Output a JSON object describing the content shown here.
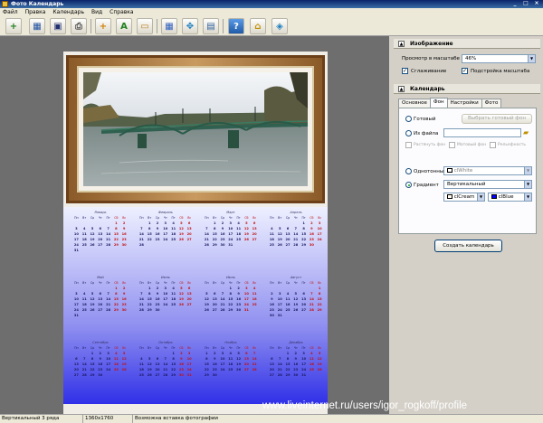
{
  "window": {
    "title": "Фото Календарь",
    "controls": [
      "_",
      "□",
      "×"
    ]
  },
  "menu": [
    "Файл",
    "Правка",
    "Календарь",
    "Вид",
    "Справка"
  ],
  "toolbar": {
    "buttons": [
      {
        "name": "open-folder-icon",
        "glyph": "+"
      },
      {
        "name": "calendar-icon",
        "glyph": "▦"
      },
      {
        "name": "save-icon",
        "glyph": "▣"
      },
      {
        "name": "print-icon",
        "glyph": "⎙"
      },
      {
        "name": "add-photo-icon",
        "glyph": "+"
      },
      {
        "name": "text-icon",
        "glyph": "A"
      },
      {
        "name": "image-icon",
        "glyph": "▭"
      },
      {
        "name": "grid-icon",
        "glyph": "▦"
      },
      {
        "name": "move-icon",
        "glyph": "✥"
      },
      {
        "name": "page-setup-icon",
        "glyph": "▤"
      },
      {
        "name": "help-icon",
        "glyph": "?"
      },
      {
        "name": "bag-icon",
        "glyph": "⌂"
      },
      {
        "name": "box-icon",
        "glyph": "◈"
      }
    ]
  },
  "calendar": {
    "weekdays": [
      "Пн",
      "Вт",
      "Ср",
      "Чт",
      "Пт",
      "Сб",
      "Вс"
    ],
    "months": [
      {
        "name": "Январь",
        "rows": [
          [
            "",
            "",
            "",
            "",
            "",
            "1",
            "2"
          ],
          [
            "3",
            "4",
            "5",
            "6",
            "7",
            "8",
            "9"
          ],
          [
            "10",
            "11",
            "12",
            "13",
            "14",
            "15",
            "16"
          ],
          [
            "17",
            "18",
            "19",
            "20",
            "21",
            "22",
            "23"
          ],
          [
            "24",
            "25",
            "26",
            "27",
            "28",
            "29",
            "30"
          ],
          [
            "31",
            "",
            "",
            "",
            "",
            "",
            ""
          ]
        ]
      },
      {
        "name": "Февраль",
        "rows": [
          [
            "",
            "1",
            "2",
            "3",
            "4",
            "5",
            "6"
          ],
          [
            "7",
            "8",
            "9",
            "10",
            "11",
            "12",
            "13"
          ],
          [
            "14",
            "15",
            "16",
            "17",
            "18",
            "19",
            "20"
          ],
          [
            "21",
            "22",
            "23",
            "24",
            "25",
            "26",
            "27"
          ],
          [
            "28",
            "",
            "",
            "",
            "",
            "",
            ""
          ]
        ]
      },
      {
        "name": "Март",
        "rows": [
          [
            "",
            "1",
            "2",
            "3",
            "4",
            "5",
            "6"
          ],
          [
            "7",
            "8",
            "9",
            "10",
            "11",
            "12",
            "13"
          ],
          [
            "14",
            "15",
            "16",
            "17",
            "18",
            "19",
            "20"
          ],
          [
            "21",
            "22",
            "23",
            "24",
            "25",
            "26",
            "27"
          ],
          [
            "28",
            "29",
            "30",
            "31",
            "",
            "",
            ""
          ]
        ]
      },
      {
        "name": "Апрель",
        "rows": [
          [
            "",
            "",
            "",
            "",
            "1",
            "2",
            "3"
          ],
          [
            "4",
            "5",
            "6",
            "7",
            "8",
            "9",
            "10"
          ],
          [
            "11",
            "12",
            "13",
            "14",
            "15",
            "16",
            "17"
          ],
          [
            "18",
            "19",
            "20",
            "21",
            "22",
            "23",
            "24"
          ],
          [
            "25",
            "26",
            "27",
            "28",
            "29",
            "30",
            ""
          ]
        ]
      },
      {
        "name": "Май",
        "rows": [
          [
            "",
            "",
            "",
            "",
            "",
            "1",
            "2"
          ],
          [
            "3",
            "4",
            "5",
            "6",
            "7",
            "8",
            "9"
          ],
          [
            "10",
            "11",
            "12",
            "13",
            "14",
            "15",
            "16"
          ],
          [
            "17",
            "18",
            "19",
            "20",
            "21",
            "22",
            "23"
          ],
          [
            "24",
            "25",
            "26",
            "27",
            "28",
            "29",
            "30"
          ],
          [
            "31",
            "",
            "",
            "",
            "",
            "",
            ""
          ]
        ]
      },
      {
        "name": "Июнь",
        "rows": [
          [
            "",
            "1",
            "2",
            "3",
            "4",
            "5",
            "6"
          ],
          [
            "7",
            "8",
            "9",
            "10",
            "11",
            "12",
            "13"
          ],
          [
            "14",
            "15",
            "16",
            "17",
            "18",
            "19",
            "20"
          ],
          [
            "21",
            "22",
            "23",
            "24",
            "25",
            "26",
            "27"
          ],
          [
            "28",
            "29",
            "30",
            "",
            "",
            "",
            ""
          ]
        ]
      },
      {
        "name": "Июль",
        "rows": [
          [
            "",
            "",
            "",
            "1",
            "2",
            "3",
            "4"
          ],
          [
            "5",
            "6",
            "7",
            "8",
            "9",
            "10",
            "11"
          ],
          [
            "12",
            "13",
            "14",
            "15",
            "16",
            "17",
            "18"
          ],
          [
            "19",
            "20",
            "21",
            "22",
            "23",
            "24",
            "25"
          ],
          [
            "26",
            "27",
            "28",
            "29",
            "30",
            "31",
            ""
          ]
        ]
      },
      {
        "name": "Август",
        "rows": [
          [
            "",
            "",
            "",
            "",
            "",
            "",
            "1"
          ],
          [
            "2",
            "3",
            "4",
            "5",
            "6",
            "7",
            "8"
          ],
          [
            "9",
            "10",
            "11",
            "12",
            "13",
            "14",
            "15"
          ],
          [
            "16",
            "17",
            "18",
            "19",
            "20",
            "21",
            "22"
          ],
          [
            "23",
            "24",
            "25",
            "26",
            "27",
            "28",
            "29"
          ],
          [
            "30",
            "31",
            "",
            "",
            "",
            "",
            ""
          ]
        ]
      },
      {
        "name": "Сентябрь",
        "rows": [
          [
            "",
            "",
            "1",
            "2",
            "3",
            "4",
            "5"
          ],
          [
            "6",
            "7",
            "8",
            "9",
            "10",
            "11",
            "12"
          ],
          [
            "13",
            "14",
            "15",
            "16",
            "17",
            "18",
            "19"
          ],
          [
            "20",
            "21",
            "22",
            "23",
            "24",
            "25",
            "26"
          ],
          [
            "27",
            "28",
            "29",
            "30",
            "",
            "",
            ""
          ]
        ]
      },
      {
        "name": "Октябрь",
        "rows": [
          [
            "",
            "",
            "",
            "",
            "1",
            "2",
            "3"
          ],
          [
            "4",
            "5",
            "6",
            "7",
            "8",
            "9",
            "10"
          ],
          [
            "11",
            "12",
            "13",
            "14",
            "15",
            "16",
            "17"
          ],
          [
            "18",
            "19",
            "20",
            "21",
            "22",
            "23",
            "24"
          ],
          [
            "25",
            "26",
            "27",
            "28",
            "29",
            "30",
            "31"
          ]
        ]
      },
      {
        "name": "Ноябрь",
        "rows": [
          [
            "1",
            "2",
            "3",
            "4",
            "5",
            "6",
            "7"
          ],
          [
            "8",
            "9",
            "10",
            "11",
            "12",
            "13",
            "14"
          ],
          [
            "15",
            "16",
            "17",
            "18",
            "19",
            "20",
            "21"
          ],
          [
            "22",
            "23",
            "24",
            "25",
            "26",
            "27",
            "28"
          ],
          [
            "29",
            "30",
            "",
            "",
            "",
            "",
            ""
          ]
        ]
      },
      {
        "name": "Декабрь",
        "rows": [
          [
            "",
            "",
            "1",
            "2",
            "3",
            "4",
            "5"
          ],
          [
            "6",
            "7",
            "8",
            "9",
            "10",
            "11",
            "12"
          ],
          [
            "13",
            "14",
            "15",
            "16",
            "17",
            "18",
            "19"
          ],
          [
            "20",
            "21",
            "22",
            "23",
            "24",
            "25",
            "26"
          ],
          [
            "27",
            "28",
            "29",
            "30",
            "31",
            "",
            ""
          ]
        ]
      }
    ]
  },
  "panel": {
    "image_section": "Изображение",
    "zoom_label": "Просмотр в масштабе",
    "zoom_value": "46%",
    "smooth_label": "Сглаживание",
    "smooth_checked": true,
    "fit_label": "Подстройка масштаба",
    "fit_checked": true,
    "calendar_section": "Календарь",
    "tabs": [
      "Основное",
      "Фон",
      "Настройки",
      "Фото"
    ],
    "active_tab": "Фон",
    "ready_label": "Готовый",
    "choose_ready_button": "Выбрать готовый фон",
    "from_file_label": "Из файла",
    "from_file_value": "",
    "stretch_label": "Растянуть фон",
    "matte_label": "Матовый фон",
    "relief_label": "Рельефность",
    "solid_label": "Однотонный",
    "solid_color": "clWhite",
    "gradient_label": "Градиент",
    "gradient_type": "Вертикальный",
    "gradient_from": "clCream",
    "gradient_to": "clBlue",
    "create_button": "Создать календарь"
  },
  "status": {
    "layout": "Вертикальный 3 ряда",
    "size": "1360x1760",
    "hint": "Возможна вставка фотографии"
  },
  "watermark": "www.liveinternet.ru/users/igor_rogkoff/profile",
  "colors": {
    "gradient_to": "#0000ff",
    "gradient_from": "#fffbf0",
    "holiday": "#c01010"
  }
}
